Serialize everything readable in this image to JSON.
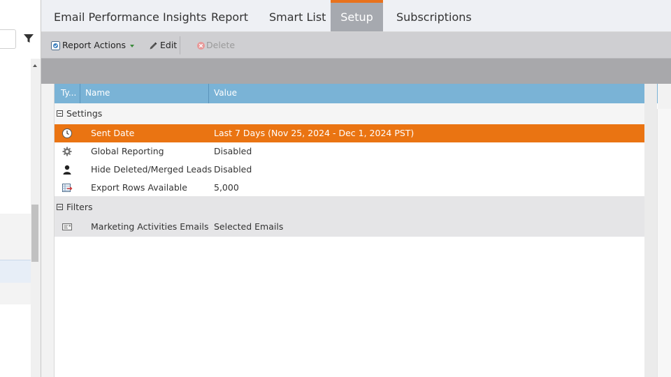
{
  "tabs": [
    {
      "label": "Email Performance Insights",
      "active": false
    },
    {
      "label": "Report",
      "active": false
    },
    {
      "label": "Smart List",
      "active": false
    },
    {
      "label": "Setup",
      "active": true
    },
    {
      "label": "Subscriptions",
      "active": false
    }
  ],
  "toolbar": {
    "report_actions": "Report Actions",
    "edit": "Edit",
    "delete": "Delete"
  },
  "grid": {
    "columns": [
      "Ty...",
      "Name",
      "Value"
    ],
    "groups": [
      {
        "label": "Settings",
        "rows": [
          {
            "icon": "clock-icon",
            "name": "Sent Date",
            "value": "Last 7 Days (Nov 25, 2024 - Dec 1, 2024 PST)",
            "selected": true
          },
          {
            "icon": "gear-icon",
            "name": "Global Reporting",
            "value": "Disabled",
            "selected": false
          },
          {
            "icon": "person-icon",
            "name": "Hide Deleted/Merged Leads",
            "value": "Disabled",
            "selected": false
          },
          {
            "icon": "export-rows-icon",
            "name": "Export Rows Available",
            "value": "5,000",
            "selected": false
          }
        ]
      },
      {
        "label": "Filters",
        "rows": [
          {
            "icon": "email-icon",
            "name": "Marketing Activities Emails",
            "value": "Selected Emails",
            "selected": false
          }
        ]
      }
    ]
  },
  "colors": {
    "accent_orange": "#ea7412",
    "header_blue": "#7ab3d6",
    "tab_active_bg": "#a6a9af"
  }
}
